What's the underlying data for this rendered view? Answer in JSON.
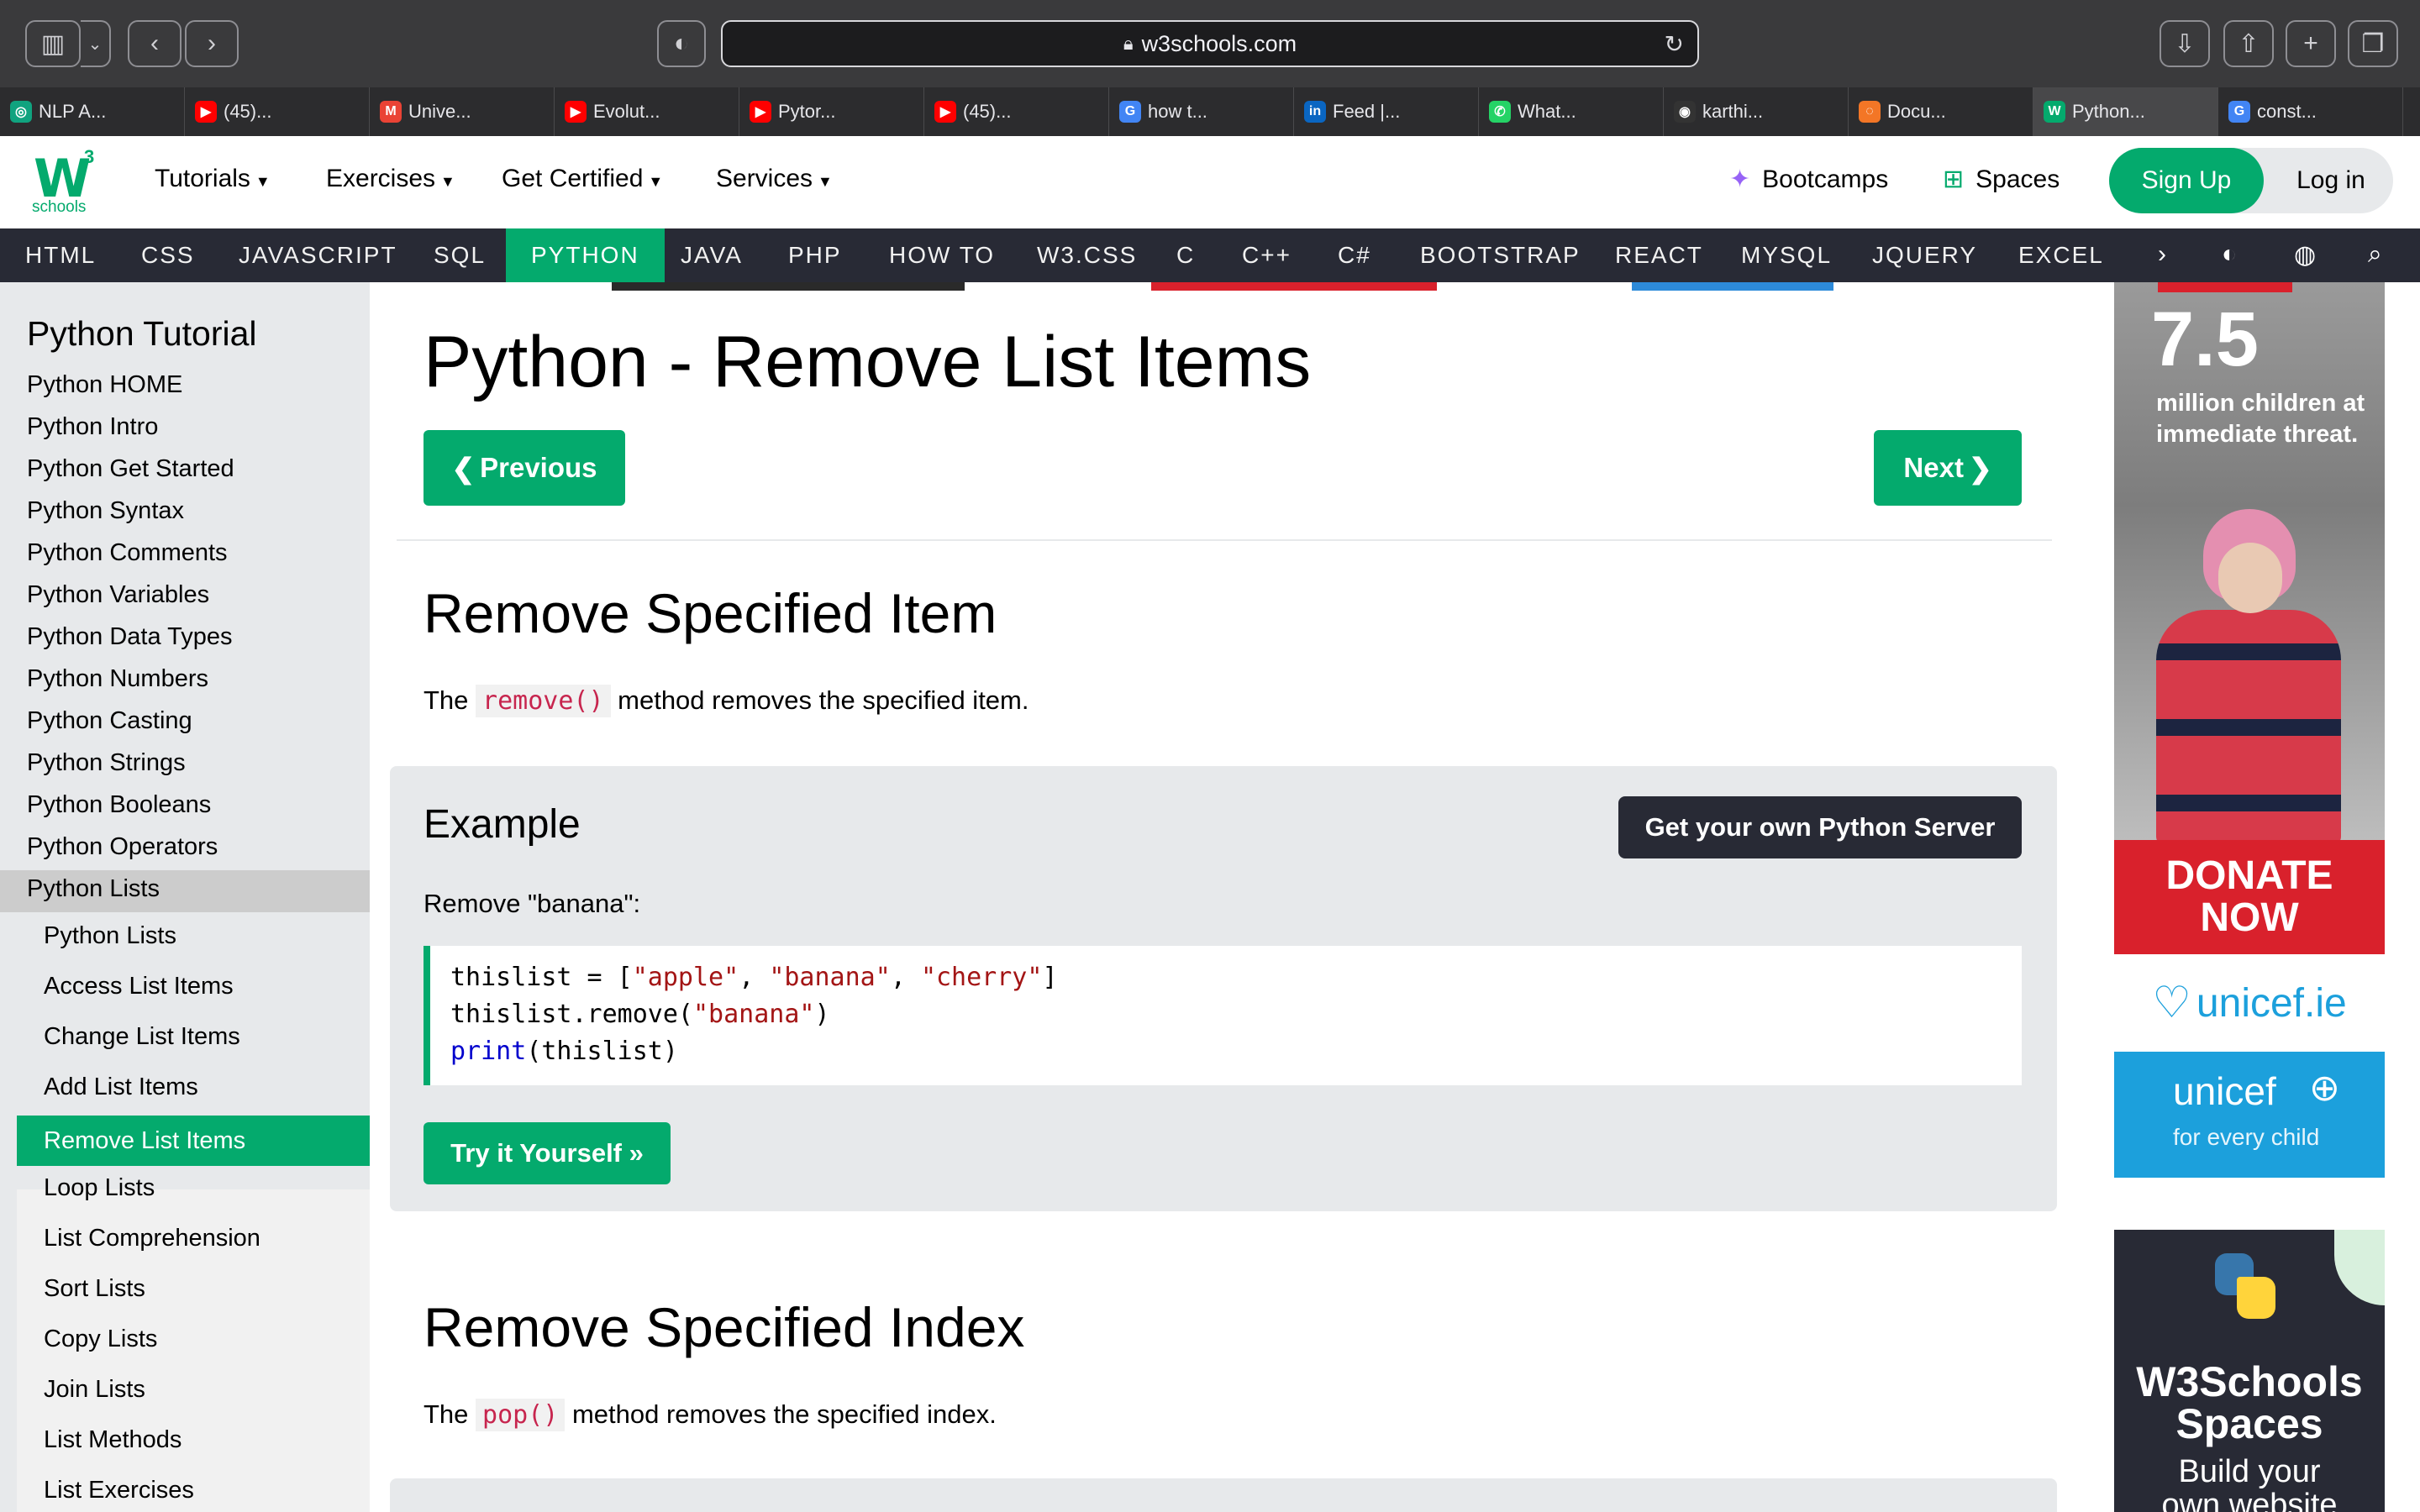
{
  "browser": {
    "url": "w3schools.com",
    "tabs": [
      {
        "label": "NLP A...",
        "icon": "openai-icon",
        "color": "#10a37f"
      },
      {
        "label": "(45)...",
        "icon": "youtube-icon",
        "color": "#ff0000"
      },
      {
        "label": "Unive...",
        "icon": "gmail-icon",
        "color": "#ea4335"
      },
      {
        "label": "Evolut...",
        "icon": "youtube-icon",
        "color": "#ff0000"
      },
      {
        "label": "Pytor...",
        "icon": "youtube-icon",
        "color": "#ff0000"
      },
      {
        "label": "(45)...",
        "icon": "youtube-icon",
        "color": "#ff0000"
      },
      {
        "label": "how t...",
        "icon": "google-icon",
        "color": "#4285f4"
      },
      {
        "label": "Feed |...",
        "icon": "linkedin-icon",
        "color": "#0a66c2"
      },
      {
        "label": "What...",
        "icon": "whatsapp-icon",
        "color": "#25d366"
      },
      {
        "label": "karthi...",
        "icon": "github-icon",
        "color": "#333333"
      },
      {
        "label": "Docu...",
        "icon": "jupyter-icon",
        "color": "#f37626"
      },
      {
        "label": "Python...",
        "icon": "w3schools-icon",
        "color": "#04aa6d"
      },
      {
        "label": "const...",
        "icon": "google-icon",
        "color": "#4285f4"
      }
    ]
  },
  "header": {
    "logo_sup": "3",
    "logo_text": "schools",
    "nav": [
      "Tutorials",
      "Exercises",
      "Get Certified",
      "Services"
    ],
    "bootcamps": "Bootcamps",
    "spaces": "Spaces",
    "signup": "Sign Up",
    "login": "Log in"
  },
  "topics": [
    "HTML",
    "CSS",
    "JAVASCRIPT",
    "SQL",
    "PYTHON",
    "JAVA",
    "PHP",
    "HOW TO",
    "W3.CSS",
    "C",
    "C++",
    "C#",
    "BOOTSTRAP",
    "REACT",
    "MYSQL",
    "JQUERY",
    "EXCEL"
  ],
  "sidebar": {
    "title": "Python Tutorial",
    "items": [
      "Python HOME",
      "Python Intro",
      "Python Get Started",
      "Python Syntax",
      "Python Comments",
      "Python Variables",
      "Python Data Types",
      "Python Numbers",
      "Python Casting",
      "Python Strings",
      "Python Booleans",
      "Python Operators",
      "Python Lists"
    ],
    "sub_items": [
      "Python Lists",
      "Access List Items",
      "Change List Items",
      "Add List Items",
      "Remove List Items",
      "Loop Lists",
      "List Comprehension",
      "Sort Lists",
      "Copy Lists",
      "Join Lists",
      "List Methods",
      "List Exercises"
    ]
  },
  "main": {
    "title": "Python - Remove List Items",
    "prev": "Previous",
    "next": "Next",
    "section1": {
      "heading": "Remove Specified Item",
      "text_before": "The ",
      "code": "remove()",
      "text_after": " method removes the specified item."
    },
    "example": {
      "title": "Example",
      "server_button": "Get your own Python Server",
      "desc": "Remove \"banana\":",
      "try_button": "Try it Yourself »",
      "code_l1_a": "thislist = [",
      "code_l1_s1": "\"apple\"",
      "code_l1_c1": ", ",
      "code_l1_s2": "\"banana\"",
      "code_l1_c2": ", ",
      "code_l1_s3": "\"cherry\"",
      "code_l1_end": "]",
      "code_l2_a": "thislist.remove(",
      "code_l2_s": "\"banana\"",
      "code_l2_end": ")",
      "code_l3_kw": "print",
      "code_l3_rest": "(thislist)"
    },
    "section2": {
      "heading": "Remove Specified Index",
      "text_before": "The ",
      "code": "pop()",
      "text_after": " method removes the specified index."
    }
  },
  "ads": {
    "unicef_stat": "7.5",
    "unicef_sub": "million children at immediate threat.",
    "donate_l1": "DONATE",
    "donate_l2": "NOW",
    "unicef_site": "unicef.ie",
    "unicef_brand": "unicef",
    "unicef_tagline": "for every child",
    "spaces_title_l1": "W3Schools",
    "spaces_title_l2": "Spaces",
    "spaces_sub_l1": "Build your",
    "spaces_sub_l2": "own website"
  }
}
